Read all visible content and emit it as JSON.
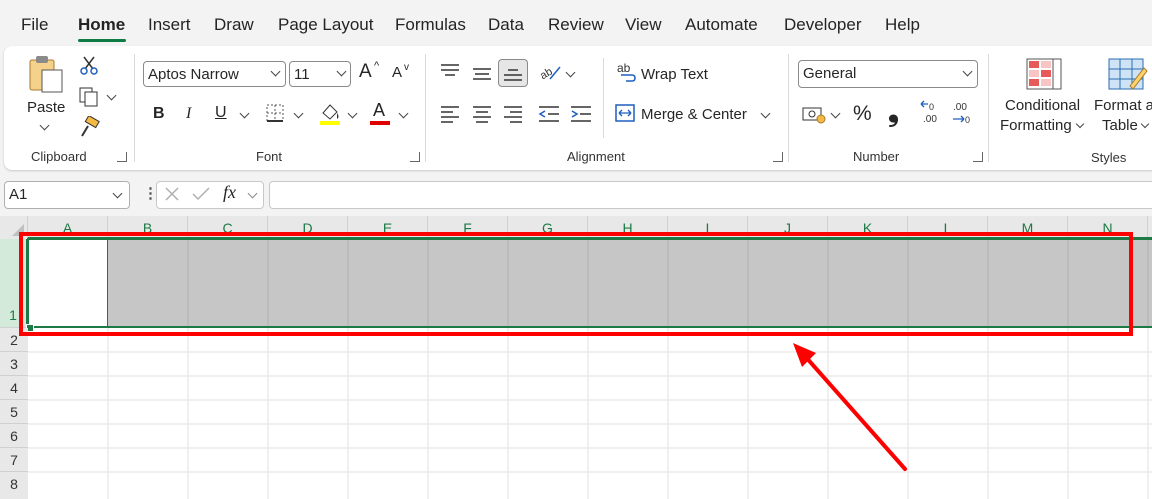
{
  "menu": {
    "tabs": [
      "File",
      "Home",
      "Insert",
      "Draw",
      "Page Layout",
      "Formulas",
      "Data",
      "Review",
      "View",
      "Automate",
      "Developer",
      "Help"
    ],
    "active": "Home"
  },
  "clipboard": {
    "paste_label": "Paste",
    "group_label": "Clipboard"
  },
  "font": {
    "name": "Aptos Narrow",
    "size": "11",
    "group_label": "Font",
    "bold": "B",
    "italic": "I",
    "underline": "U",
    "grow": "A",
    "shrink": "A",
    "font_color_glyph": "A",
    "highlight_color": "#ffff00",
    "font_color": "#e00000"
  },
  "alignment": {
    "wrap_text": "Wrap Text",
    "merge_center": "Merge & Center",
    "group_label": "Alignment",
    "wrap_icon_text": "ab"
  },
  "number": {
    "format": "General",
    "percent": "%",
    "comma": "❟",
    "group_label": "Number",
    "inc_decimal": ".00",
    "dec_decimal": ".00"
  },
  "styles": {
    "conditional_line1": "Conditional",
    "conditional_line2": "Formatting",
    "format_table_line1": "Format as",
    "format_table_line2": "Table",
    "group_label": "Styles"
  },
  "formula_bar": {
    "name_box": "A1",
    "fx": "fx",
    "formula": ""
  },
  "sheet": {
    "columns": [
      "A",
      "B",
      "C",
      "D",
      "E",
      "F",
      "G",
      "H",
      "I",
      "J",
      "K",
      "L",
      "M",
      "N"
    ],
    "rows": [
      "1",
      "2",
      "3",
      "4",
      "5",
      "6",
      "7",
      "8"
    ],
    "selected_row": "1",
    "active_cell": "A1"
  },
  "annotation": {
    "color": "#ff0000"
  }
}
